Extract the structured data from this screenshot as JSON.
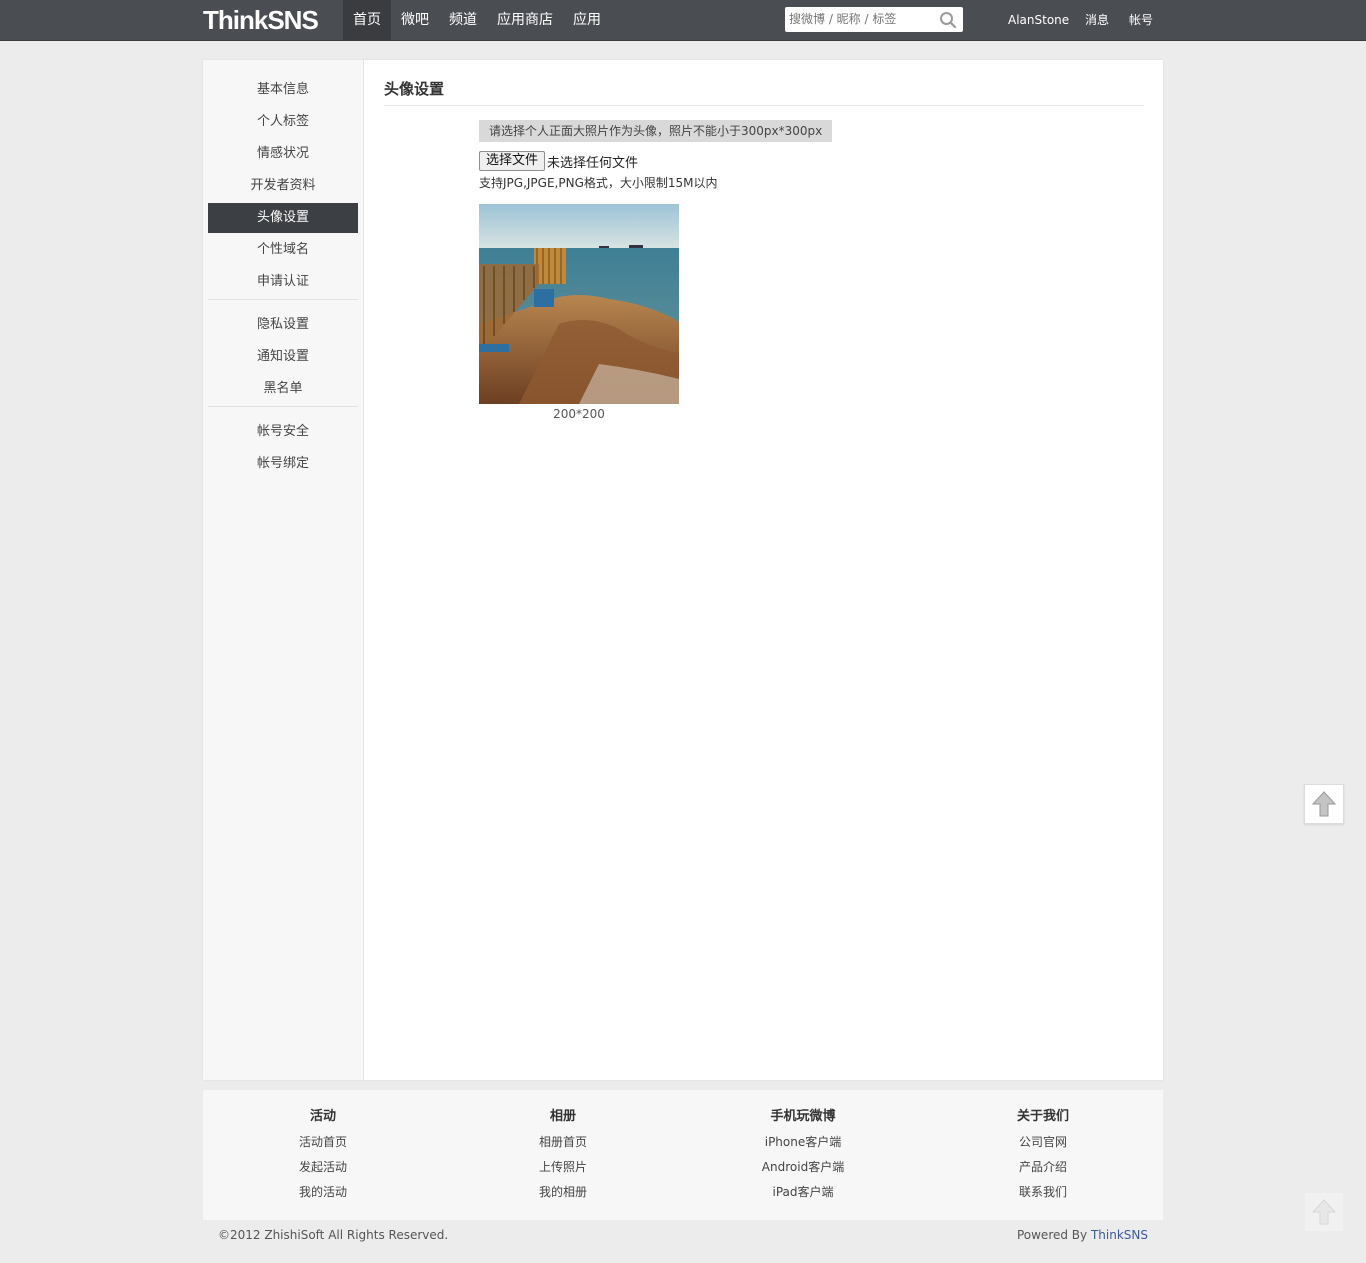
{
  "header": {
    "logo": "ThinkSNS",
    "nav": [
      "首页",
      "微吧",
      "频道",
      "应用商店",
      "应用"
    ],
    "search_placeholder": "搜微博 / 昵称 / 标签",
    "username": "AlanStone",
    "messages": "消息",
    "account": "帐号"
  },
  "sidebar": {
    "groups": [
      [
        "基本信息",
        "个人标签",
        "情感状况",
        "开发者资料",
        "头像设置",
        "个性域名",
        "申请认证"
      ],
      [
        "隐私设置",
        "通知设置",
        "黑名单"
      ],
      [
        "帐号安全",
        "帐号绑定"
      ]
    ],
    "active": "头像设置"
  },
  "content": {
    "title": "头像设置",
    "hint": "请选择个人正面大照片作为头像，照片不能小于300px*300px",
    "choose_file": "选择文件",
    "file_status": "未选择任何文件",
    "format_hint": "支持JPG,JPGE,PNG格式，大小限制15M以内",
    "avatar_size": "200*200"
  },
  "footer": {
    "columns": [
      {
        "title": "活动",
        "links": [
          "活动首页",
          "发起活动",
          "我的活动"
        ]
      },
      {
        "title": "相册",
        "links": [
          "相册首页",
          "上传照片",
          "我的相册"
        ]
      },
      {
        "title": "手机玩微博",
        "links": [
          "iPhone客户端",
          "Android客户端",
          "iPad客户端"
        ]
      },
      {
        "title": "关于我们",
        "links": [
          "公司官网",
          "产品介绍",
          "联系我们"
        ]
      }
    ],
    "copyright": "©2012 ZhishiSoft All Rights Reserved.",
    "powered_prefix": "Powered By ",
    "powered_link": "ThinkSNS"
  },
  "colors": {
    "topbar": "#4a4d52",
    "active_sidebar": "#3c3f44",
    "link_blue": "#3b5998"
  },
  "icons": {
    "search": "search-icon",
    "back_to_top": "arrow-up-icon"
  }
}
